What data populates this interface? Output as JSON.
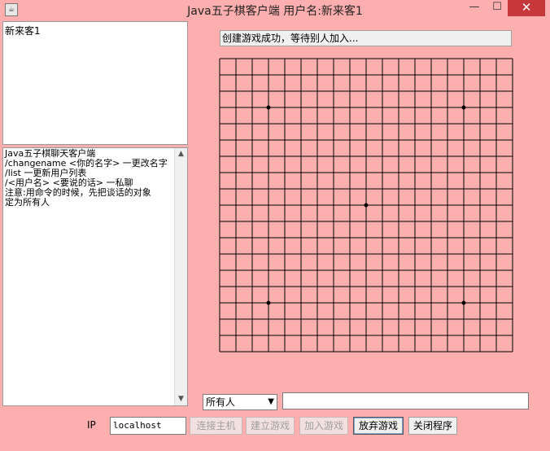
{
  "window": {
    "title": "Java五子棋客户端   用户名:新来客1",
    "minimize_glyph": "—",
    "maximize_glyph": "☐",
    "close_glyph": "✕",
    "icon": "java-icon"
  },
  "users": {
    "items": [
      "新来客1"
    ]
  },
  "chat": {
    "log": "Java五子棋聊天客户端\n/changename <你的名字> 一更改名字\n/list 一更新用户列表\n/<用户名> <要说的话> 一私聊\n注意:用命令的时候，先把谈话的对象\n定为所有人"
  },
  "game": {
    "status": "创建游戏成功，等待别人加入...",
    "board_lines": 19,
    "star_points": [
      [
        3,
        3
      ],
      [
        15,
        3
      ],
      [
        9,
        9
      ],
      [
        3,
        15
      ],
      [
        15,
        15
      ]
    ]
  },
  "input": {
    "target_value": "所有人",
    "message_value": ""
  },
  "controls": {
    "ip_label": "IP",
    "ip_value": "localhost",
    "connect_label": "连接主机",
    "create_label": "建立游戏",
    "join_label": "加入游戏",
    "giveup_label": "放弃游戏",
    "quit_label": "关闭程序"
  },
  "colors": {
    "background": "#fdaeae",
    "close_button": "#c7383a"
  }
}
